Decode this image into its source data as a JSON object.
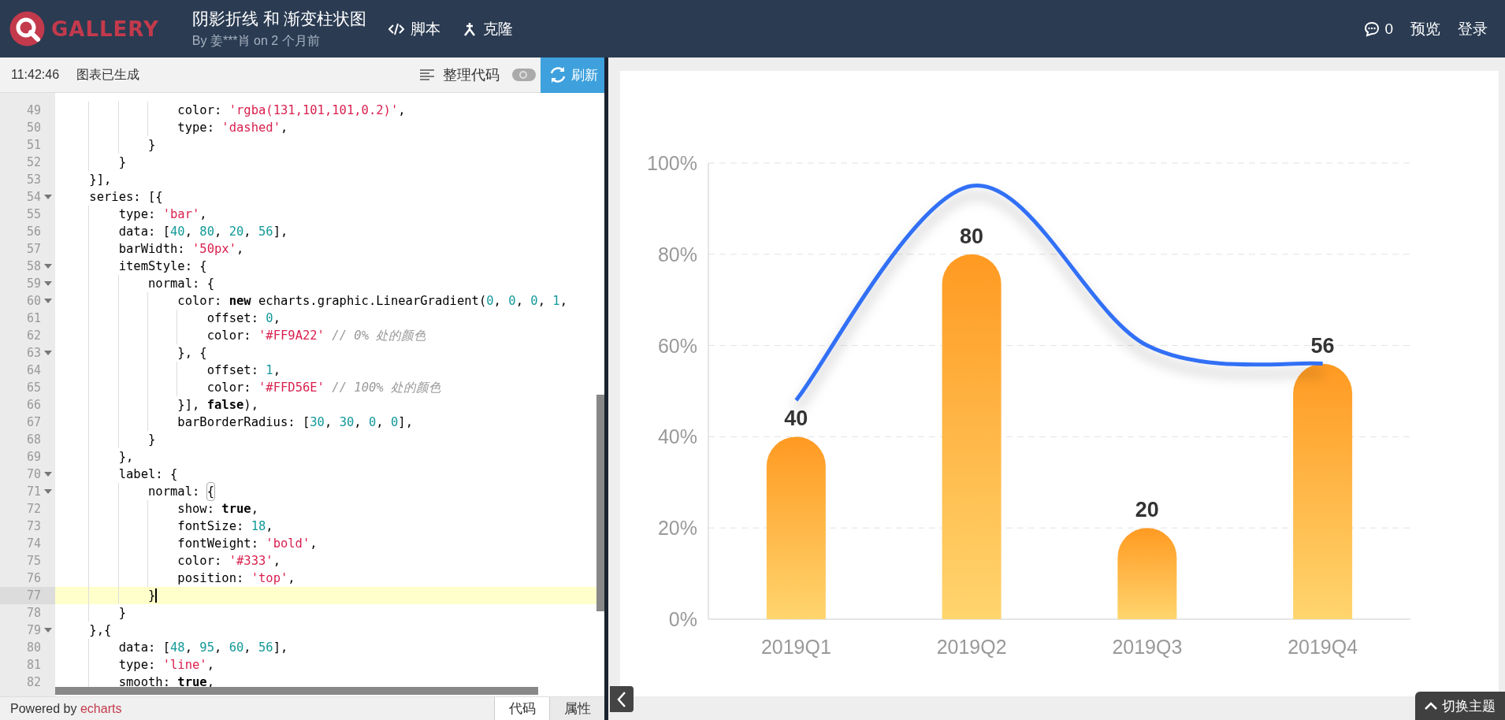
{
  "header": {
    "logo_text": "GALLERY",
    "title": "阴影折线 和 渐变柱状图",
    "byline": "By 姜***肖 on 2 个月前",
    "actions": [
      {
        "kind": "code",
        "label": "脚本"
      },
      {
        "kind": "fork",
        "label": "克隆"
      }
    ],
    "comment_count": "0",
    "links": [
      "预览",
      "登录"
    ]
  },
  "toolbar": {
    "time": "11:42:46",
    "status": "图表已生成",
    "format_label": "整理代码",
    "toggle_on": false,
    "refresh_label": "刷新"
  },
  "code": {
    "lines": [
      {
        "number": "49",
        "foldable": false,
        "current": false,
        "tokens": [
          {
            "kind": "plain",
            "text": "                color: "
          },
          {
            "kind": "string",
            "text": "'rgba(131,101,101,0.2)'"
          },
          {
            "kind": "plain",
            "text": ","
          }
        ]
      },
      {
        "number": "50",
        "foldable": false,
        "current": false,
        "tokens": [
          {
            "kind": "plain",
            "text": "                type: "
          },
          {
            "kind": "string",
            "text": "'dashed'"
          },
          {
            "kind": "plain",
            "text": ","
          }
        ]
      },
      {
        "number": "51",
        "foldable": false,
        "current": false,
        "tokens": [
          {
            "kind": "plain",
            "text": "            }"
          }
        ]
      },
      {
        "number": "52",
        "foldable": false,
        "current": false,
        "tokens": [
          {
            "kind": "plain",
            "text": "        }"
          }
        ]
      },
      {
        "number": "53",
        "foldable": false,
        "current": false,
        "tokens": [
          {
            "kind": "plain",
            "text": "    }],"
          }
        ]
      },
      {
        "number": "54",
        "foldable": true,
        "current": false,
        "tokens": [
          {
            "kind": "plain",
            "text": "    series: [{"
          }
        ]
      },
      {
        "number": "55",
        "foldable": false,
        "current": false,
        "tokens": [
          {
            "kind": "plain",
            "text": "        type: "
          },
          {
            "kind": "string",
            "text": "'bar'"
          },
          {
            "kind": "plain",
            "text": ","
          }
        ]
      },
      {
        "number": "56",
        "foldable": false,
        "current": false,
        "tokens": [
          {
            "kind": "plain",
            "text": "        data: ["
          },
          {
            "kind": "number",
            "text": "40"
          },
          {
            "kind": "plain",
            "text": ", "
          },
          {
            "kind": "number",
            "text": "80"
          },
          {
            "kind": "plain",
            "text": ", "
          },
          {
            "kind": "number",
            "text": "20"
          },
          {
            "kind": "plain",
            "text": ", "
          },
          {
            "kind": "number",
            "text": "56"
          },
          {
            "kind": "plain",
            "text": "],"
          }
        ]
      },
      {
        "number": "57",
        "foldable": false,
        "current": false,
        "tokens": [
          {
            "kind": "plain",
            "text": "        barWidth: "
          },
          {
            "kind": "string",
            "text": "'50px'"
          },
          {
            "kind": "plain",
            "text": ","
          }
        ]
      },
      {
        "number": "58",
        "foldable": true,
        "current": false,
        "tokens": [
          {
            "kind": "plain",
            "text": "        itemStyle: {"
          }
        ]
      },
      {
        "number": "59",
        "foldable": true,
        "current": false,
        "tokens": [
          {
            "kind": "plain",
            "text": "            normal: {"
          }
        ]
      },
      {
        "number": "60",
        "foldable": true,
        "current": false,
        "tokens": [
          {
            "kind": "plain",
            "text": "                color: "
          },
          {
            "kind": "keyword",
            "text": "new"
          },
          {
            "kind": "plain",
            "text": " echarts.graphic.LinearGradient("
          },
          {
            "kind": "number",
            "text": "0"
          },
          {
            "kind": "plain",
            "text": ", "
          },
          {
            "kind": "number",
            "text": "0"
          },
          {
            "kind": "plain",
            "text": ", "
          },
          {
            "kind": "number",
            "text": "0"
          },
          {
            "kind": "plain",
            "text": ", "
          },
          {
            "kind": "number",
            "text": "1"
          },
          {
            "kind": "plain",
            "text": ","
          }
        ]
      },
      {
        "number": "61",
        "foldable": false,
        "current": false,
        "tokens": [
          {
            "kind": "plain",
            "text": "                    offset: "
          },
          {
            "kind": "number",
            "text": "0"
          },
          {
            "kind": "plain",
            "text": ","
          }
        ]
      },
      {
        "number": "62",
        "foldable": false,
        "current": false,
        "tokens": [
          {
            "kind": "plain",
            "text": "                    color: "
          },
          {
            "kind": "string",
            "text": "'#FF9A22'"
          },
          {
            "kind": "comment",
            "text": " // 0% 处的颜色"
          }
        ]
      },
      {
        "number": "63",
        "foldable": true,
        "current": false,
        "tokens": [
          {
            "kind": "plain",
            "text": "                }, {"
          }
        ]
      },
      {
        "number": "64",
        "foldable": false,
        "current": false,
        "tokens": [
          {
            "kind": "plain",
            "text": "                    offset: "
          },
          {
            "kind": "number",
            "text": "1"
          },
          {
            "kind": "plain",
            "text": ","
          }
        ]
      },
      {
        "number": "65",
        "foldable": false,
        "current": false,
        "tokens": [
          {
            "kind": "plain",
            "text": "                    color: "
          },
          {
            "kind": "string",
            "text": "'#FFD56E'"
          },
          {
            "kind": "comment",
            "text": " // 100% 处的颜色"
          }
        ]
      },
      {
        "number": "66",
        "foldable": false,
        "current": false,
        "tokens": [
          {
            "kind": "plain",
            "text": "                }], "
          },
          {
            "kind": "keyword",
            "text": "false"
          },
          {
            "kind": "plain",
            "text": "),"
          }
        ]
      },
      {
        "number": "67",
        "foldable": false,
        "current": false,
        "tokens": [
          {
            "kind": "plain",
            "text": "                barBorderRadius: ["
          },
          {
            "kind": "number",
            "text": "30"
          },
          {
            "kind": "plain",
            "text": ", "
          },
          {
            "kind": "number",
            "text": "30"
          },
          {
            "kind": "plain",
            "text": ", "
          },
          {
            "kind": "number",
            "text": "0"
          },
          {
            "kind": "plain",
            "text": ", "
          },
          {
            "kind": "number",
            "text": "0"
          },
          {
            "kind": "plain",
            "text": "],"
          }
        ]
      },
      {
        "number": "68",
        "foldable": false,
        "current": false,
        "tokens": [
          {
            "kind": "plain",
            "text": "            }"
          }
        ]
      },
      {
        "number": "69",
        "foldable": false,
        "current": false,
        "tokens": [
          {
            "kind": "plain",
            "text": "        },"
          }
        ]
      },
      {
        "number": "70",
        "foldable": true,
        "current": false,
        "tokens": [
          {
            "kind": "plain",
            "text": "        label: {"
          }
        ]
      },
      {
        "number": "71",
        "foldable": true,
        "current": false,
        "tokens": [
          {
            "kind": "plain",
            "text": "            normal: "
          },
          {
            "kind": "matched",
            "text": "{"
          }
        ]
      },
      {
        "number": "72",
        "foldable": false,
        "current": false,
        "tokens": [
          {
            "kind": "plain",
            "text": "                show: "
          },
          {
            "kind": "keyword",
            "text": "true"
          },
          {
            "kind": "plain",
            "text": ","
          }
        ]
      },
      {
        "number": "73",
        "foldable": false,
        "current": false,
        "tokens": [
          {
            "kind": "plain",
            "text": "                fontSize: "
          },
          {
            "kind": "number",
            "text": "18"
          },
          {
            "kind": "plain",
            "text": ","
          }
        ]
      },
      {
        "number": "74",
        "foldable": false,
        "current": false,
        "tokens": [
          {
            "kind": "plain",
            "text": "                fontWeight: "
          },
          {
            "kind": "string",
            "text": "'bold'"
          },
          {
            "kind": "plain",
            "text": ","
          }
        ]
      },
      {
        "number": "75",
        "foldable": false,
        "current": false,
        "tokens": [
          {
            "kind": "plain",
            "text": "                color: "
          },
          {
            "kind": "string",
            "text": "'#333'"
          },
          {
            "kind": "plain",
            "text": ","
          }
        ]
      },
      {
        "number": "76",
        "foldable": false,
        "current": false,
        "tokens": [
          {
            "kind": "plain",
            "text": "                position: "
          },
          {
            "kind": "string",
            "text": "'top'"
          },
          {
            "kind": "plain",
            "text": ","
          }
        ]
      },
      {
        "number": "77",
        "foldable": false,
        "current": true,
        "tokens": [
          {
            "kind": "plain",
            "text": "            }"
          }
        ]
      },
      {
        "number": "78",
        "foldable": false,
        "current": false,
        "tokens": [
          {
            "kind": "plain",
            "text": "        }"
          }
        ]
      },
      {
        "number": "79",
        "foldable": true,
        "current": false,
        "tokens": [
          {
            "kind": "plain",
            "text": "    },{"
          }
        ]
      },
      {
        "number": "80",
        "foldable": false,
        "current": false,
        "tokens": [
          {
            "kind": "plain",
            "text": "        data: ["
          },
          {
            "kind": "number",
            "text": "48"
          },
          {
            "kind": "plain",
            "text": ", "
          },
          {
            "kind": "number",
            "text": "95"
          },
          {
            "kind": "plain",
            "text": ", "
          },
          {
            "kind": "number",
            "text": "60"
          },
          {
            "kind": "plain",
            "text": ", "
          },
          {
            "kind": "number",
            "text": "56"
          },
          {
            "kind": "plain",
            "text": "],"
          }
        ]
      },
      {
        "number": "81",
        "foldable": false,
        "current": false,
        "tokens": [
          {
            "kind": "plain",
            "text": "        type: "
          },
          {
            "kind": "string",
            "text": "'line'"
          },
          {
            "kind": "plain",
            "text": ","
          }
        ]
      },
      {
        "number": "82",
        "foldable": false,
        "current": false,
        "tokens": [
          {
            "kind": "plain",
            "text": "        smooth: "
          },
          {
            "kind": "keyword",
            "text": "true"
          },
          {
            "kind": "plain",
            "text": ","
          }
        ]
      }
    ]
  },
  "footer": {
    "powered_prefix": "Powered by",
    "powered_link": "echarts",
    "tabs": [
      {
        "label": "代码",
        "selected": true
      },
      {
        "label": "属性",
        "selected": false
      }
    ]
  },
  "chart": {
    "chart_data": {
      "type": "bar",
      "categories": [
        "2019Q1",
        "2019Q2",
        "2019Q3",
        "2019Q4"
      ],
      "ylim": [
        0,
        100
      ],
      "yticks": [
        {
          "value": 0,
          "label": "0%"
        },
        {
          "value": 20,
          "label": "20%"
        },
        {
          "value": 40,
          "label": "40%"
        },
        {
          "value": 60,
          "label": "60%"
        },
        {
          "value": 80,
          "label": "80%"
        },
        {
          "value": 100,
          "label": "100%"
        }
      ],
      "grid": true,
      "value_labels": [
        [
          "40",
          "80",
          "20",
          "56"
        ],
        [
          null,
          null,
          null,
          null
        ]
      ],
      "series": [
        {
          "type": "bar",
          "color": "#ff9a22",
          "values": [
            40,
            80,
            20,
            56
          ]
        },
        {
          "type": "line",
          "color": "#3370f5",
          "values": [
            48,
            95,
            60,
            56
          ]
        }
      ]
    }
  },
  "theme_button": "切换主题"
}
